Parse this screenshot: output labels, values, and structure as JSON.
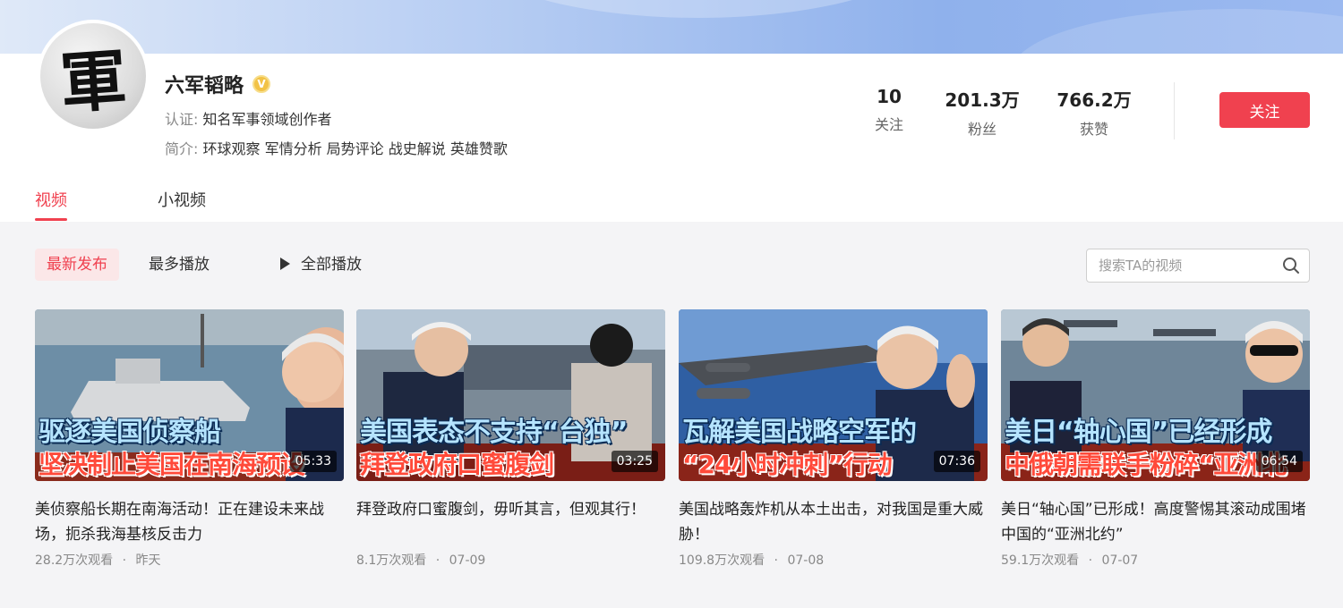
{
  "profile": {
    "name": "六军韬略",
    "cert_label": "认证:",
    "cert_value": "知名军事领域创作者",
    "intro_label": "简介:",
    "intro_value": "环球观察 军情分析 局势评论 战史解说 英雄赞歌",
    "avatar_glyph": "軍"
  },
  "stats": [
    {
      "num": "10",
      "label": "关注"
    },
    {
      "num": "201.3万",
      "label": "粉丝"
    },
    {
      "num": "766.2万",
      "label": "获赞"
    }
  ],
  "follow_label": "关注",
  "tabs": [
    {
      "label": "视频",
      "active": true
    },
    {
      "label": "小视频",
      "active": false
    }
  ],
  "filters": {
    "latest": "最新发布",
    "most_played": "最多播放",
    "play_all": "全部播放"
  },
  "search": {
    "placeholder": "搜索TA的视频"
  },
  "videos": [
    {
      "cap1": "驱逐美国侦察船",
      "cap2": "坚决制止美国在南海预设",
      "duration": "05:33",
      "title": "美侦察船长期在南海活动！正在建设未来战场，扼杀我海基核反击力",
      "views": "28.2万次观看",
      "date": "昨天"
    },
    {
      "cap1": "美国表态不支持“台独”",
      "cap2": "拜登政府口蜜腹剑",
      "duration": "03:25",
      "title": "拜登政府口蜜腹剑，毋听其言，但观其行！",
      "views": "8.1万次观看",
      "date": "07-09"
    },
    {
      "cap1": "瓦解美国战略空军的",
      "cap2": "“24小时冲刺”行动",
      "duration": "07:36",
      "title": "美国战略轰炸机从本土出击，对我国是重大威胁！",
      "views": "109.8万次观看",
      "date": "07-08"
    },
    {
      "cap1": "美日“轴心国”已经形成",
      "cap2": "中俄朝需联手粉碎“亚洲北",
      "duration": "06:54",
      "title": "美日“轴心国”已形成！高度警惕其滚动成围堵中国的“亚洲北约”",
      "views": "59.1万次观看",
      "date": "07-07"
    }
  ],
  "meta_separator": "·"
}
